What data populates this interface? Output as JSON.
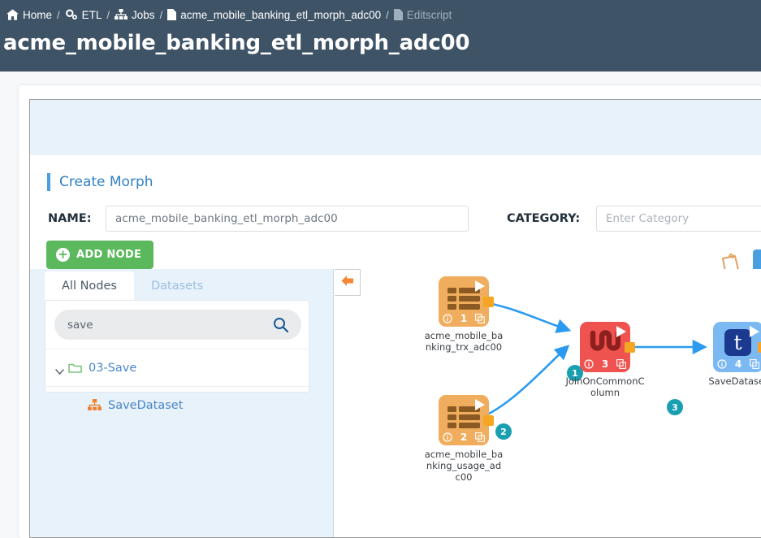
{
  "breadcrumb": [
    {
      "label": "Home",
      "icon": "home-icon",
      "muted": false
    },
    {
      "label": "ETL",
      "icon": "gears-icon",
      "muted": false
    },
    {
      "label": "Jobs",
      "icon": "sitemap-icon",
      "muted": false
    },
    {
      "label": "acme_mobile_banking_etl_morph_adc00",
      "icon": "file-icon",
      "muted": false
    },
    {
      "label": "Editscript",
      "icon": "file-icon",
      "muted": true
    }
  ],
  "separator": "/",
  "page_title": "acme_mobile_banking_etl_morph_adc00",
  "form": {
    "section_title": "Create Morph",
    "name_label": "NAME:",
    "name_value": "acme_mobile_banking_etl_morph_adc00",
    "category_label": "CATEGORY:",
    "category_value": "",
    "category_placeholder": "Enter Category",
    "add_node_label": "ADD NODE",
    "add_node_plus": "+",
    "notes_icon": "sticky-notes-icon",
    "blue_action_icon": "action-button"
  },
  "panel": {
    "tabs": [
      {
        "label": "All Nodes",
        "active": true
      },
      {
        "label": "Datasets",
        "active": false
      }
    ],
    "search": {
      "value": "save",
      "placeholder": "",
      "icon": "search-icon"
    },
    "tree": [
      {
        "label": "03-Save",
        "icon": "folder-icon",
        "type": "folder",
        "expanded": true
      },
      {
        "label": "SaveDataset",
        "icon": "sitemap-icon",
        "type": "leaf"
      }
    ]
  },
  "canvas": {
    "collapse_icon": "arrow-left-icon",
    "nodes": [
      {
        "id": 1,
        "label": "acme_mobile_banking_trx_adc00",
        "number": "1",
        "color": "orange",
        "icon": "table-icon"
      },
      {
        "id": 2,
        "label": "acme_mobile_banking_usage_adc00",
        "number": "2",
        "color": "orange",
        "icon": "table-icon"
      },
      {
        "id": 3,
        "label": "JoinOnCommonColumn",
        "number": "3",
        "color": "red",
        "icon": "join-icon"
      },
      {
        "id": 4,
        "label": "SaveDataset",
        "number": "4",
        "color": "blue",
        "icon": "tumblr-t-icon"
      }
    ],
    "edges": [
      {
        "badge": "1",
        "from": 1,
        "to": 3
      },
      {
        "badge": "2",
        "from": 2,
        "to": 3
      },
      {
        "badge": "3",
        "from": 3,
        "to": 4
      }
    ],
    "chip_info_icon": "info-icon",
    "chip_copy_icon": "copy-icon",
    "chip_play_icon": "play-icon"
  },
  "colors": {
    "header_bg": "#3e5366",
    "accent_blue": "#4a9fe0",
    "green": "#5cb85c",
    "orange_node": "#f0ad5e",
    "red_node": "#ef5350",
    "blue_node": "#7cb9f2",
    "edge": "#2b9bef",
    "badge": "#1a9fb0",
    "panel_bg": "#e8f2fb"
  }
}
